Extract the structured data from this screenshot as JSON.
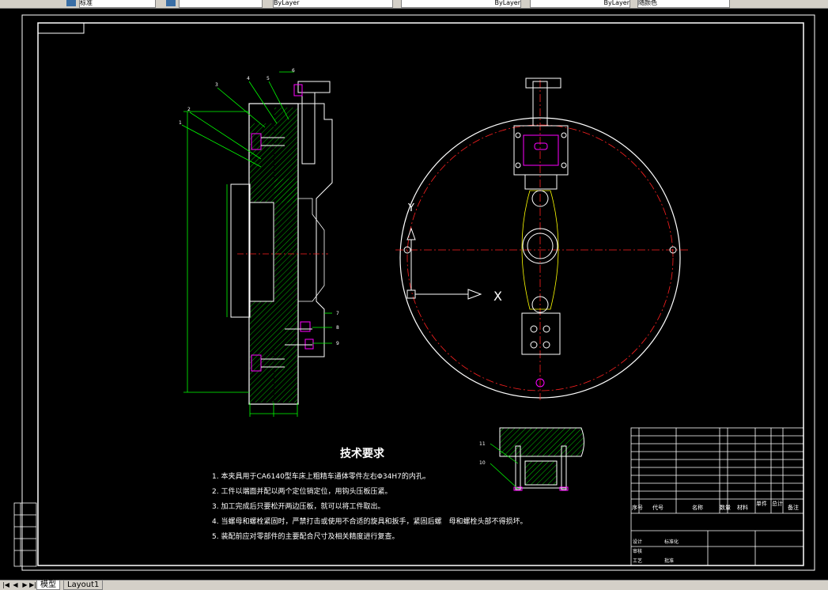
{
  "toolbar": {
    "style_label": "标准",
    "layer1": "ByLayer",
    "layer2": "ByLayer",
    "layer3": "ByLayer",
    "plot_style": "随颜色"
  },
  "drawing": {
    "colors": {
      "outline": "#ffffff",
      "dim": "#00ff00",
      "center": "#ff2020",
      "magenta": "#ff00ff",
      "hatch": "#00ff00",
      "cyan": "#00ffff",
      "yellow": "#ffff00"
    },
    "callouts": [
      "1",
      "2",
      "3",
      "4",
      "5",
      "6",
      "7",
      "8",
      "9",
      "10",
      "11"
    ],
    "axis_x": "X",
    "axis_y": "Y",
    "notes_title": "技术要求",
    "notes": [
      "1. 本夹具用于CA6140型车床上粗精车通体零件左右Φ34H7的内孔。",
      "2. 工件以端面并配以两个定位销定位，用钩头压板压紧。",
      "3. 加工完成后只要松开两边压板，就可以将工件取出。",
      "4. 当螺母和螺栓紧固时，严禁打击或使用不合适的旋具和扳手，紧固后螺　母和螺栓头部不得损坏。",
      "5. 装配前应对零部件的主要配合尺寸及相关精度进行复查。"
    ],
    "title_block": {
      "header_cols": [
        "序号",
        "代号",
        "名称",
        "数量",
        "材料",
        "单件",
        "总计",
        "备注"
      ],
      "sign_rows": [
        "设计",
        "审核",
        "工艺",
        "标准化",
        "批准"
      ]
    }
  },
  "tabs": {
    "items": [
      {
        "label": "模型",
        "active": true
      },
      {
        "label": "Layout1",
        "active": false
      }
    ]
  }
}
